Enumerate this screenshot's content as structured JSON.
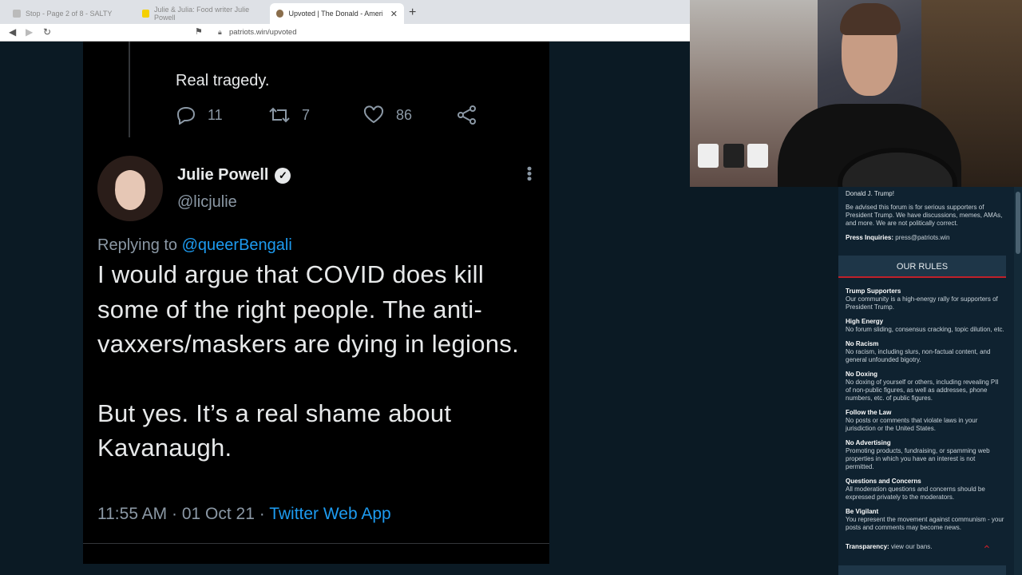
{
  "browser": {
    "tabs": [
      {
        "label": "Stop - Page 2 of 8 - SALTY",
        "active": false
      },
      {
        "label": "Julie & Julia: Food writer Julie Powell",
        "active": false
      },
      {
        "label": "Upvoted | The Donald - America",
        "active": true
      }
    ],
    "url": "patriots.win/upvoted"
  },
  "tweet": {
    "previous_text": "Real tragedy.",
    "previous_actions": {
      "replies": "11",
      "retweets": "7",
      "likes": "86"
    },
    "author_name": "Julie Powell",
    "author_handle": "@licjulie",
    "replying_prefix": "Replying to",
    "replying_to": "@queerBengali",
    "body_paragraph_1": "I would argue that COVID does kill some of the right people. The anti-vaxxers/maskers are dying in legions.",
    "body_paragraph_2": "But yes. It’s a real shame about Kavanaugh.",
    "timestamp": "11:55 AM · 01 Oct 21 ·",
    "app": "Twitter Web App"
  },
  "sidebar": {
    "top_line": "Donald J. Trump!",
    "advisory": "Be advised this forum is for serious supporters of President Trump. We have discussions, memes, AMAs, and more. We are not politically correct.",
    "press_label": "Press Inquiries:",
    "press_email": "press@patriots.win",
    "rules_title": "OUR RULES",
    "rules": [
      {
        "title": "Trump Supporters",
        "desc": "Our community is a high-energy rally for supporters of President Trump."
      },
      {
        "title": "High Energy",
        "desc": "No forum sliding, consensus cracking, topic dilution, etc."
      },
      {
        "title": "No Racism",
        "desc": "No racism, including slurs, non-factual content, and general unfounded bigotry."
      },
      {
        "title": "No Doxing",
        "desc": "No doxing of yourself or others, including revealing PII of non-public figures, as well as addresses, phone numbers, etc. of public figures."
      },
      {
        "title": "Follow the Law",
        "desc": "No posts or comments that violate laws in your jurisdiction or the United States."
      },
      {
        "title": "No Advertising",
        "desc": "Promoting products, fundraising, or spamming web properties in which you have an interest is not permitted."
      },
      {
        "title": "Questions and Concerns",
        "desc": "All moderation questions and concerns should be expressed privately to the moderators."
      },
      {
        "title": "Be Vigilant",
        "desc": "You represent the movement against communism - your posts and comments may become news."
      }
    ],
    "transparency_label": "Transparency:",
    "transparency_link": "view our bans."
  },
  "colors": {
    "link_blue": "#1d9bf0",
    "rules_red": "#c0202a",
    "sidebar_bg": "#0f2230"
  }
}
